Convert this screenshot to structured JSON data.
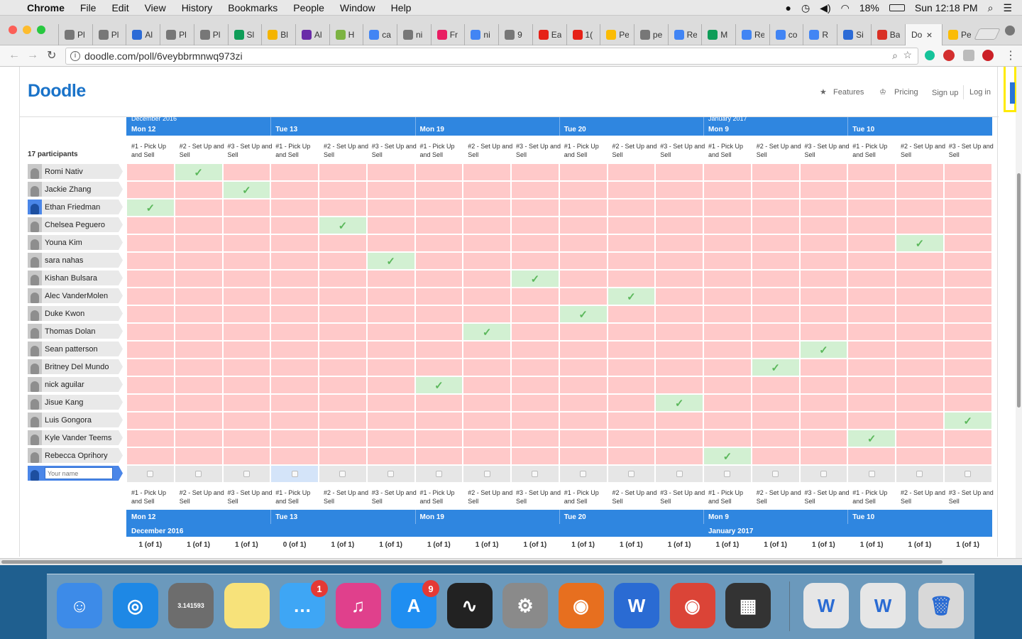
{
  "menubar": {
    "app": "Chrome",
    "items": [
      "File",
      "Edit",
      "View",
      "History",
      "Bookmarks",
      "People",
      "Window",
      "Help"
    ],
    "battery": "18%",
    "clock": "Sun 12:18 PM"
  },
  "tabs": [
    {
      "label": "Pl",
      "color": "#777"
    },
    {
      "label": "Pl",
      "color": "#777"
    },
    {
      "label": "Al",
      "color": "#2c6bd6"
    },
    {
      "label": "Pl",
      "color": "#777"
    },
    {
      "label": "Pl",
      "color": "#777"
    },
    {
      "label": "Sl",
      "color": "#0f9d58"
    },
    {
      "label": "Bl",
      "color": "#f4b400"
    },
    {
      "label": "Al",
      "color": "#6a2ca8"
    },
    {
      "label": "H",
      "color": "#7cb342"
    },
    {
      "label": "ca",
      "color": "#4285f4"
    },
    {
      "label": "ni",
      "color": "#777"
    },
    {
      "label": "Fr",
      "color": "#e91e63"
    },
    {
      "label": "ni",
      "color": "#4285f4"
    },
    {
      "label": "9",
      "color": "#777"
    },
    {
      "label": "Ea",
      "color": "#e62117"
    },
    {
      "label": "1(",
      "color": "#e62117"
    },
    {
      "label": "Pe",
      "color": "#fbbc05"
    },
    {
      "label": "pe",
      "color": "#777"
    },
    {
      "label": "Re",
      "color": "#4285f4"
    },
    {
      "label": "M",
      "color": "#0f9d58"
    },
    {
      "label": "Re",
      "color": "#4285f4"
    },
    {
      "label": "co",
      "color": "#4285f4"
    },
    {
      "label": "R",
      "color": "#4285f4"
    },
    {
      "label": "Si",
      "color": "#2c6bd6"
    },
    {
      "label": "Ba",
      "color": "#d93025"
    }
  ],
  "active_tab": {
    "label": "Do",
    "close": "×"
  },
  "last_tab": {
    "label": "Pe"
  },
  "address": {
    "url": "doodle.com/poll/6veybbrmnwq973zi"
  },
  "header": {
    "logo": "Doodle",
    "features": "Features",
    "pricing": "Pricing",
    "signup": "Sign up",
    "login": "Log in"
  },
  "poll": {
    "participants_label": "17 participants",
    "months_top": [
      {
        "label": "December 2016",
        "col": 0
      },
      {
        "label": "January 2017",
        "col": 12
      }
    ],
    "days": [
      {
        "label": "Mon 12",
        "start": 0
      },
      {
        "label": "Tue 13",
        "start": 3
      },
      {
        "label": "Mon 19",
        "start": 6
      },
      {
        "label": "Tue 20",
        "start": 9
      },
      {
        "label": "Mon 9",
        "start": 12
      },
      {
        "label": "Tue 10",
        "start": 15
      }
    ],
    "months_bottom": [
      {
        "label": "December 2016",
        "col": 0
      },
      {
        "label": "January 2017",
        "col": 12
      }
    ],
    "option_labels": [
      "#1 - Pick Up and Sell",
      "#2 - Set Up and Sell",
      "#3 - Set Up and Sell"
    ],
    "participants": [
      {
        "name": "Romi Nativ",
        "yes": 1
      },
      {
        "name": "Jackie Zhang",
        "yes": 2
      },
      {
        "name": "Ethan Friedman",
        "yes": 0,
        "me": true
      },
      {
        "name": "Chelsea Peguero",
        "yes": 4
      },
      {
        "name": "Youna Kim",
        "yes": 16
      },
      {
        "name": "sara nahas",
        "yes": 5
      },
      {
        "name": "Kishan Bulsara",
        "yes": 8
      },
      {
        "name": "Alec VanderMolen",
        "yes": 10
      },
      {
        "name": "Duke Kwon",
        "yes": 9
      },
      {
        "name": "Thomas Dolan",
        "yes": 7
      },
      {
        "name": "Sean patterson",
        "yes": 14
      },
      {
        "name": "Britney Del Mundo",
        "yes": 13
      },
      {
        "name": "nick aguilar",
        "yes": 6
      },
      {
        "name": "Jisue Kang",
        "yes": 11
      },
      {
        "name": "Luis Gongora",
        "yes": 17
      },
      {
        "name": "Kyle Vander Teems",
        "yes": 15
      },
      {
        "name": "Rebecca Oprihory",
        "yes": 12
      }
    ],
    "checkmark": "✓",
    "input_placeholder": "Your name",
    "counts": [
      "1 (of 1)",
      "1 (of 1)",
      "1 (of 1)",
      "0 (of 1)",
      "1 (of 1)",
      "1 (of 1)",
      "1 (of 1)",
      "1 (of 1)",
      "1 (of 1)",
      "1 (of 1)",
      "1 (of 1)",
      "1 (of 1)",
      "1 (of 1)",
      "1 (of 1)",
      "1 (of 1)",
      "1 (of 1)",
      "1 (of 1)",
      "1 (of 1)"
    ]
  },
  "dock": [
    {
      "name": "finder",
      "label": "☺",
      "color": "#3d8be8"
    },
    {
      "name": "safari",
      "label": "◎",
      "color": "#1e88e5"
    },
    {
      "name": "calculator",
      "label": "3.141593",
      "color": "#6d6d6d"
    },
    {
      "name": "notes",
      "label": "",
      "color": "#f7e27a"
    },
    {
      "name": "messages",
      "label": "…",
      "color": "#3ea6f5",
      "badge": "1"
    },
    {
      "name": "itunes",
      "label": "♫",
      "color": "#e0408c"
    },
    {
      "name": "app-store",
      "label": "A",
      "color": "#1f8ef1",
      "badge": "9"
    },
    {
      "name": "activity-monitor",
      "label": "∿",
      "color": "#222"
    },
    {
      "name": "system-preferences",
      "label": "⚙",
      "color": "#8a8a8a"
    },
    {
      "name": "firefox",
      "label": "◉",
      "color": "#e76f1f"
    },
    {
      "name": "word",
      "label": "W",
      "color": "#2a6bd3"
    },
    {
      "name": "chrome",
      "label": "◉",
      "color": "#db4437"
    },
    {
      "name": "printer",
      "label": "▦",
      "color": "#333"
    },
    {
      "name": "window-thumb-1",
      "label": "W",
      "color": "#e6e6e6"
    },
    {
      "name": "window-thumb-2",
      "label": "W",
      "color": "#e6e6e6"
    },
    {
      "name": "trash",
      "label": "🗑",
      "color": "#d8d8d8"
    }
  ]
}
